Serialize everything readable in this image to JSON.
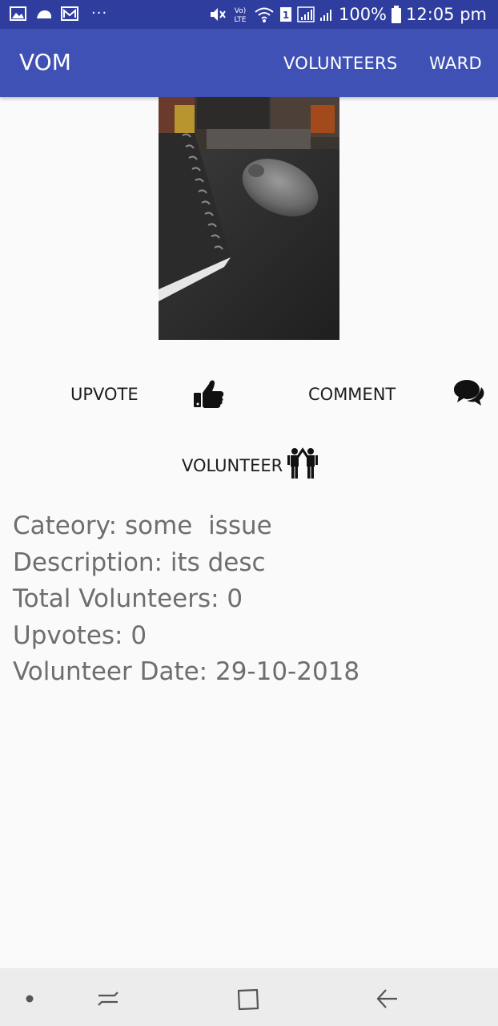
{
  "status_bar": {
    "battery": "100%",
    "time": "12:05 pm",
    "volte_label": "Vo)",
    "lte_label": "LTE",
    "sim_label": "1",
    "overflow": "···"
  },
  "app_bar": {
    "title": "VOM",
    "actions": [
      "VOLUNTEERS",
      "WARD"
    ]
  },
  "actions": {
    "upvote_label": "UPVOTE",
    "comment_label": "COMMENT",
    "volunteer_label": "VOLUNTEER"
  },
  "details": {
    "category": "Cateory: some  issue",
    "description": "Description: its desc",
    "total_volunteers": "Total Volunteers: 0",
    "upvotes": "Upvotes: 0",
    "volunteer_date": "Volunteer Date: 29-10-2018"
  },
  "icons": {
    "upvote": "thumbs-up-icon",
    "comment": "chat-bubbles-icon",
    "volunteer": "two-people-icon"
  },
  "colors": {
    "status_bar": "#2f3e9e",
    "app_bar": "#3f51b5",
    "detail_text": "#6e6e6e",
    "nav_bar": "#ececec"
  }
}
